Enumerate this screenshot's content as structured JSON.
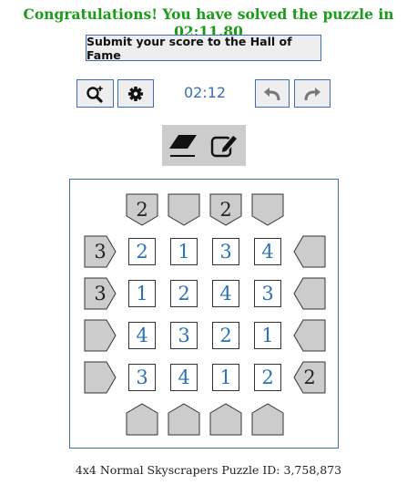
{
  "status": {
    "message": "Congratulations! You have solved the puzzle in 02:11.80",
    "color": "#1a9c1a"
  },
  "submit_button": {
    "label": "Submit your score to the Hall of Fame"
  },
  "toolbar": {
    "timer": "02:12",
    "buttons": [
      "zoom-in-icon",
      "gear-icon",
      "undo-icon",
      "redo-icon"
    ]
  },
  "input_modes": [
    "eraser-icon",
    "pencil-edit-icon"
  ],
  "puzzle": {
    "size": "4x4",
    "type": "Normal Skyscrapers",
    "clues_top": [
      "2",
      "",
      "2",
      ""
    ],
    "clues_bottom": [
      "",
      "",
      "",
      ""
    ],
    "clues_left": [
      "3",
      "3",
      "",
      ""
    ],
    "clues_right": [
      "",
      "",
      "",
      "2"
    ],
    "grid": [
      [
        "2",
        "1",
        "3",
        "4"
      ],
      [
        "1",
        "2",
        "4",
        "3"
      ],
      [
        "4",
        "3",
        "2",
        "1"
      ],
      [
        "3",
        "4",
        "1",
        "2"
      ]
    ],
    "digit_color": "#2a72b8",
    "clue_fill": "#cccccc"
  },
  "footer": {
    "label": "4x4 Normal Skyscrapers Puzzle ID: 3,758,873"
  }
}
